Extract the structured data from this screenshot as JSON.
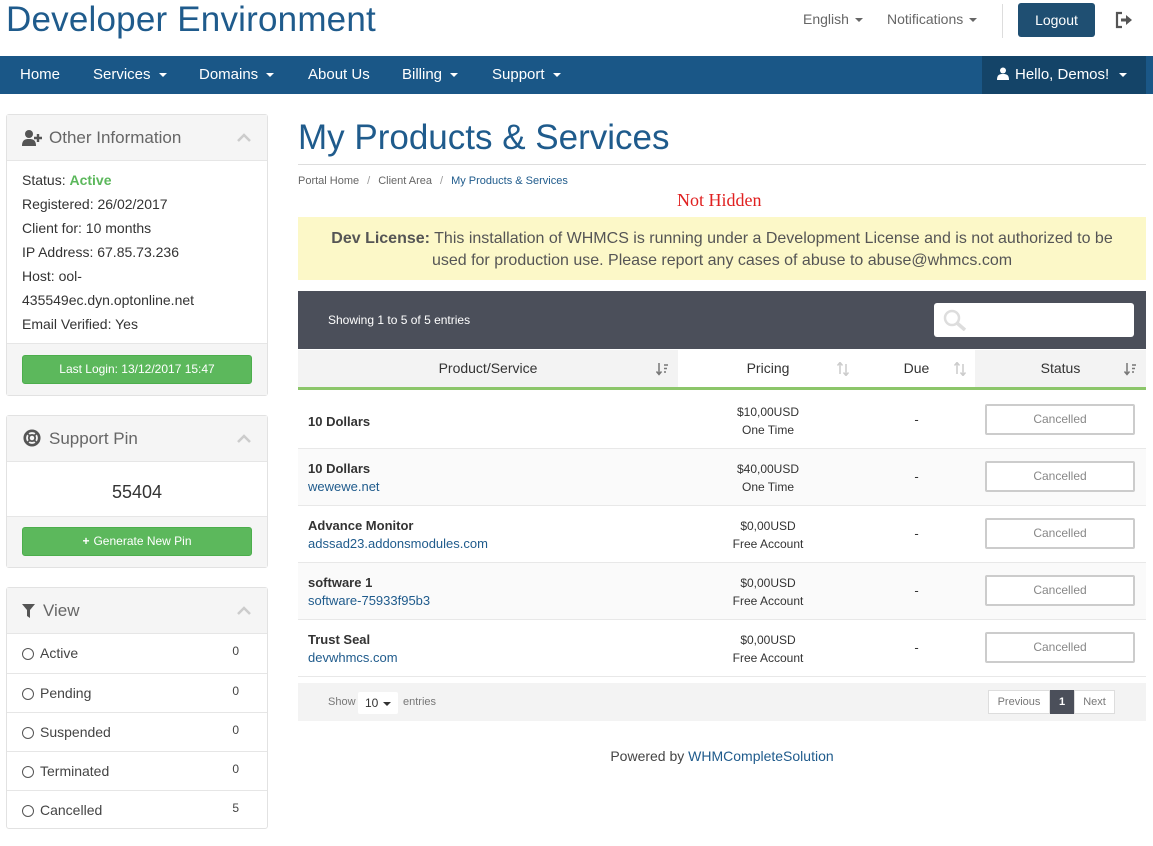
{
  "header": {
    "brand": "Developer Environment",
    "language": "English",
    "notifications": "Notifications",
    "logout": "Logout"
  },
  "nav": {
    "items": [
      "Home",
      "Services",
      "Domains",
      "About Us",
      "Billing",
      "Support"
    ],
    "user": "Hello, Demos!"
  },
  "sidebar": {
    "info": {
      "title": "Other Information",
      "status_label": "Status:",
      "status_value": "Active",
      "registered": "Registered: 26/02/2017",
      "client_for": "Client for: 10 months",
      "ip": "IP Address: 67.85.73.236",
      "host_line1": "Host: ool-",
      "host_line2": "435549ec.dyn.optonline.net",
      "email_verified": "Email Verified: Yes",
      "last_login": "Last Login: 13/12/2017 15:47"
    },
    "pin": {
      "title": "Support Pin",
      "value": "55404",
      "generate": "Generate New Pin"
    },
    "view": {
      "title": "View",
      "items": [
        {
          "label": "Active",
          "count": "0"
        },
        {
          "label": "Pending",
          "count": "0"
        },
        {
          "label": "Suspended",
          "count": "0"
        },
        {
          "label": "Terminated",
          "count": "0"
        },
        {
          "label": "Cancelled",
          "count": "5"
        }
      ]
    }
  },
  "main": {
    "title": "My Products & Services",
    "breadcrumb": [
      "Portal Home",
      "Client Area",
      "My Products & Services"
    ],
    "not_hidden": "Not Hidden",
    "alert_label": "Dev License:",
    "alert_text": "This installation of WHMCS is running under a Development License and is not authorized to be used for production use. Please report any cases of abuse to abuse@whmcs.com",
    "showing": "Showing 1 to 5 of 5 entries",
    "columns": [
      "Product/Service",
      "Pricing",
      "Due",
      "Status"
    ],
    "rows": [
      {
        "name": "10 Dollars",
        "domain": "",
        "price": "$10,00USD",
        "cycle": "One Time",
        "due": "-",
        "status": "Cancelled"
      },
      {
        "name": "10 Dollars",
        "domain": "wewewe.net",
        "price": "$40,00USD",
        "cycle": "One Time",
        "due": "-",
        "status": "Cancelled"
      },
      {
        "name": "Advance Monitor",
        "domain": "adssad23.addonsmodules.com",
        "price": "$0,00USD",
        "cycle": "Free Account",
        "due": "-",
        "status": "Cancelled"
      },
      {
        "name": "software 1",
        "domain": "software-75933f95b3",
        "price": "$0,00USD",
        "cycle": "Free Account",
        "due": "-",
        "status": "Cancelled"
      },
      {
        "name": "Trust Seal",
        "domain": "devwhmcs.com",
        "price": "$0,00USD",
        "cycle": "Free Account",
        "due": "-",
        "status": "Cancelled"
      }
    ],
    "footer": {
      "show": "Show",
      "length": "10",
      "entries": "entries",
      "previous": "Previous",
      "page": "1",
      "next": "Next"
    },
    "powered_prefix": "Powered by",
    "powered_link": "WHMCompleteSolution"
  }
}
